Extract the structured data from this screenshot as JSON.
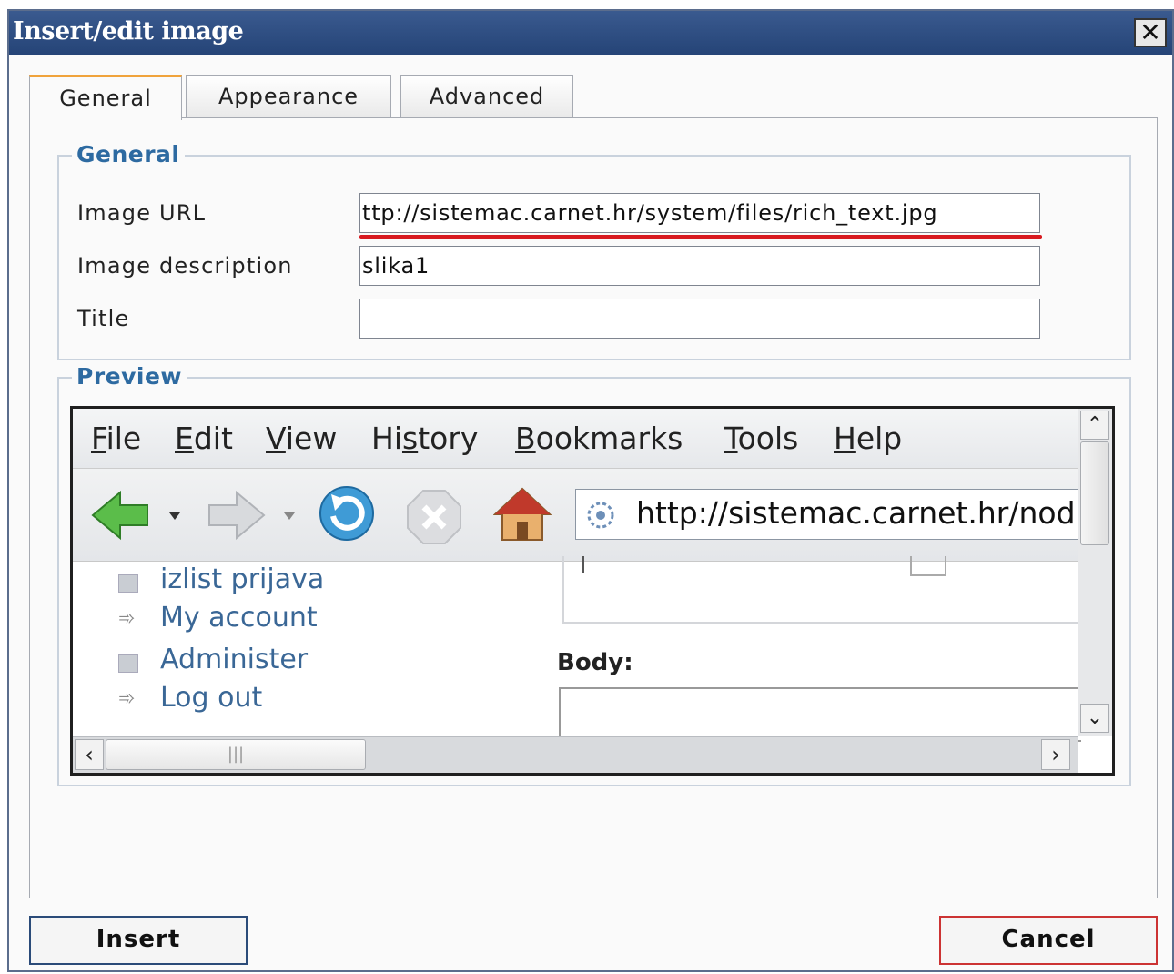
{
  "dialog": {
    "title": "Insert/edit image",
    "close_label": "✕"
  },
  "tabs": [
    {
      "label": "General"
    },
    {
      "label": "Appearance"
    },
    {
      "label": "Advanced"
    }
  ],
  "general": {
    "legend": "General",
    "image_url_label": "Image URL",
    "image_url_value": "ttp://sistemac.carnet.hr/system/files/rich_text.jpg",
    "image_description_label": "Image description",
    "image_description_value": "slika1",
    "title_label": "Title",
    "title_value": ""
  },
  "preview": {
    "legend": "Preview",
    "menu": [
      {
        "key": "F",
        "rest": "ile"
      },
      {
        "key": "E",
        "rest": "dit"
      },
      {
        "key": "V",
        "rest": "iew"
      },
      {
        "pre": "Hi",
        "key": "s",
        "rest": "tory"
      },
      {
        "key": "B",
        "rest": "ookmarks"
      },
      {
        "key": "T",
        "rest": "ools"
      },
      {
        "key": "H",
        "rest": "elp"
      }
    ],
    "address": "http://sistemac.carnet.hr/nod",
    "sidebar_items": [
      "izlist prijava",
      "My account",
      "Administer",
      "Log out"
    ],
    "body_label": "Body:",
    "hscroll_grip": "|||"
  },
  "buttons": {
    "insert": "Insert",
    "cancel": "Cancel"
  },
  "colors": {
    "titlebar": "#2f4f85",
    "active_tab_accent": "#f0a33c",
    "legend": "#2d6aa1",
    "highlight": "#d81a20"
  }
}
